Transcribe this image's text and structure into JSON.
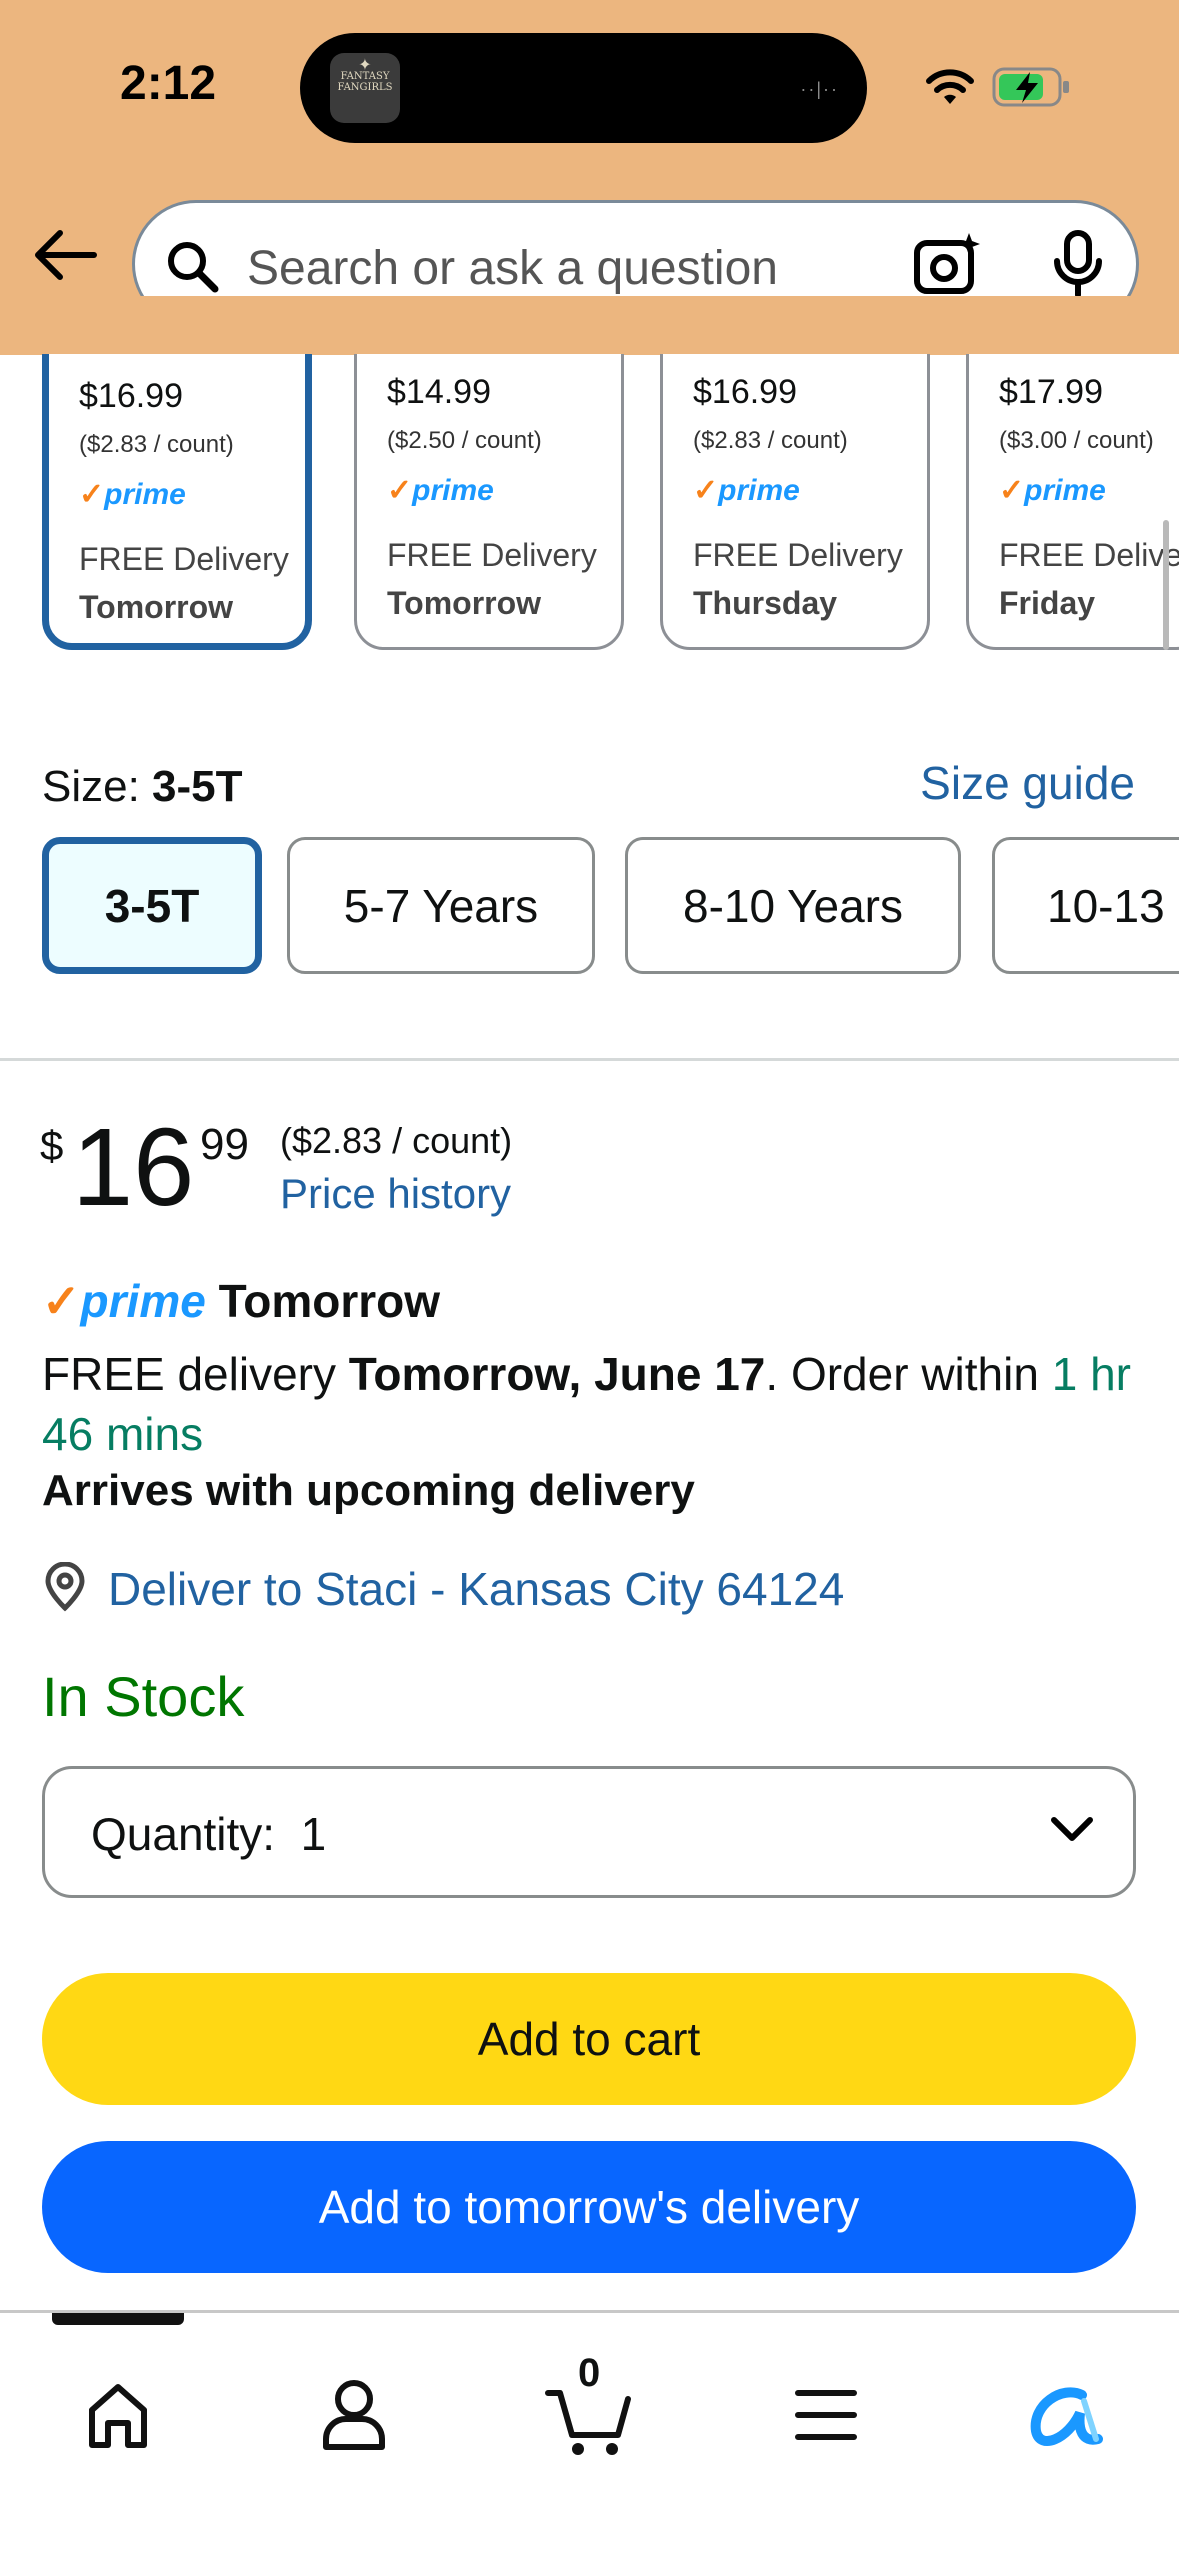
{
  "status_bar": {
    "time": "2:12",
    "app_badge": "FANTASY FANGIRLS"
  },
  "search": {
    "placeholder": "Search or ask a question"
  },
  "variants": [
    {
      "price": "$16.99",
      "unit": "($2.83 / count)",
      "prime": "prime",
      "delivery": "FREE Delivery",
      "day": "Tomorrow",
      "selected": true
    },
    {
      "price": "$14.99",
      "unit": "($2.50 / count)",
      "prime": "prime",
      "delivery": "FREE Delivery",
      "day": "Tomorrow",
      "selected": false
    },
    {
      "price": "$16.99",
      "unit": "($2.83 / count)",
      "prime": "prime",
      "delivery": "FREE Delivery",
      "day": "Thursday",
      "selected": false
    },
    {
      "price": "$17.99",
      "unit": "($3.00 / count)",
      "prime": "prime",
      "delivery": "FREE Delivery",
      "day": "Friday",
      "selected": false
    }
  ],
  "size": {
    "label": "Size: ",
    "selected_value": "3-5T",
    "guide_link": "Size guide",
    "options": [
      "3-5T",
      "5-7 Years",
      "8-10 Years",
      "10-13"
    ]
  },
  "price": {
    "currency": "$",
    "whole": "16",
    "fraction": "99",
    "unit_price": "($2.83 / count)",
    "history_link": "Price history"
  },
  "delivery": {
    "prime_label": "prime",
    "prime_day": "Tomorrow",
    "text_prefix": "FREE delivery ",
    "date": "Tomorrow, June 17",
    "text_mid": ". Order within ",
    "countdown": "1 hr 46 mins",
    "arrives": "Arrives with upcoming delivery",
    "deliver_to": "Deliver to Staci - Kansas City 64124"
  },
  "stock": {
    "status": "In Stock"
  },
  "quantity": {
    "label": "Quantity:",
    "value": "1"
  },
  "buttons": {
    "add_to_cart": "Add to cart",
    "add_tomorrow": "Add to tomorrow's delivery"
  },
  "nav": {
    "cart_count": "0"
  },
  "colors": {
    "header_bg": "#ecb67f",
    "link": "#2162a1",
    "prime_blue": "#1a98ff",
    "cart_yellow": "#ffd814",
    "tomorrow_blue": "#0866ff",
    "stock_green": "#007600",
    "countdown_green": "#067d62"
  }
}
